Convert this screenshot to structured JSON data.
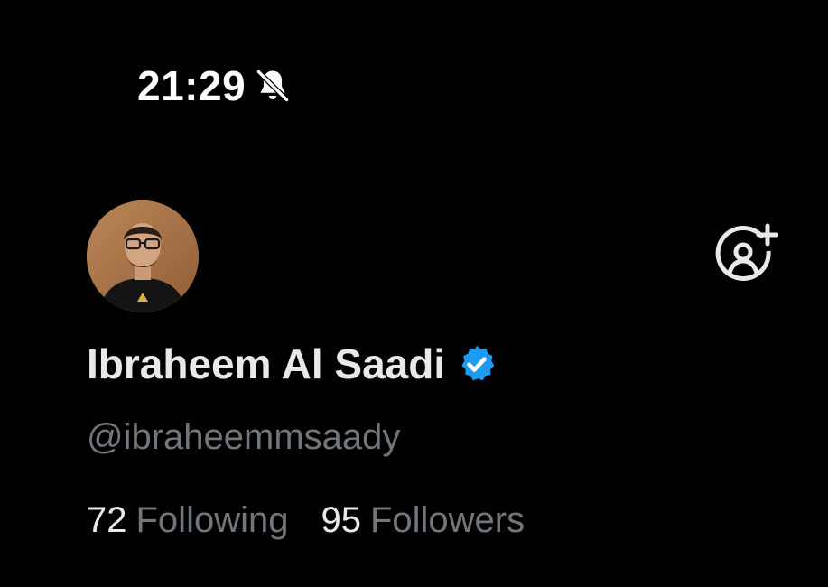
{
  "status_bar": {
    "time": "21:29",
    "silent_icon": "bell-slash-icon"
  },
  "profile": {
    "avatar_icon": "profile-photo",
    "display_name": "Ibraheem Al Saadi",
    "verified_icon": "verified-badge-icon",
    "handle": "@ibraheemmsaady",
    "following_count": "72",
    "following_label": "Following",
    "followers_count": "95",
    "followers_label": "Followers"
  },
  "actions": {
    "add_account_icon": "add-account-icon"
  },
  "colors": {
    "background": "#000000",
    "primary_text": "#e7e9ea",
    "secondary_text": "#71767b",
    "verified_blue": "#1d9bf0"
  }
}
